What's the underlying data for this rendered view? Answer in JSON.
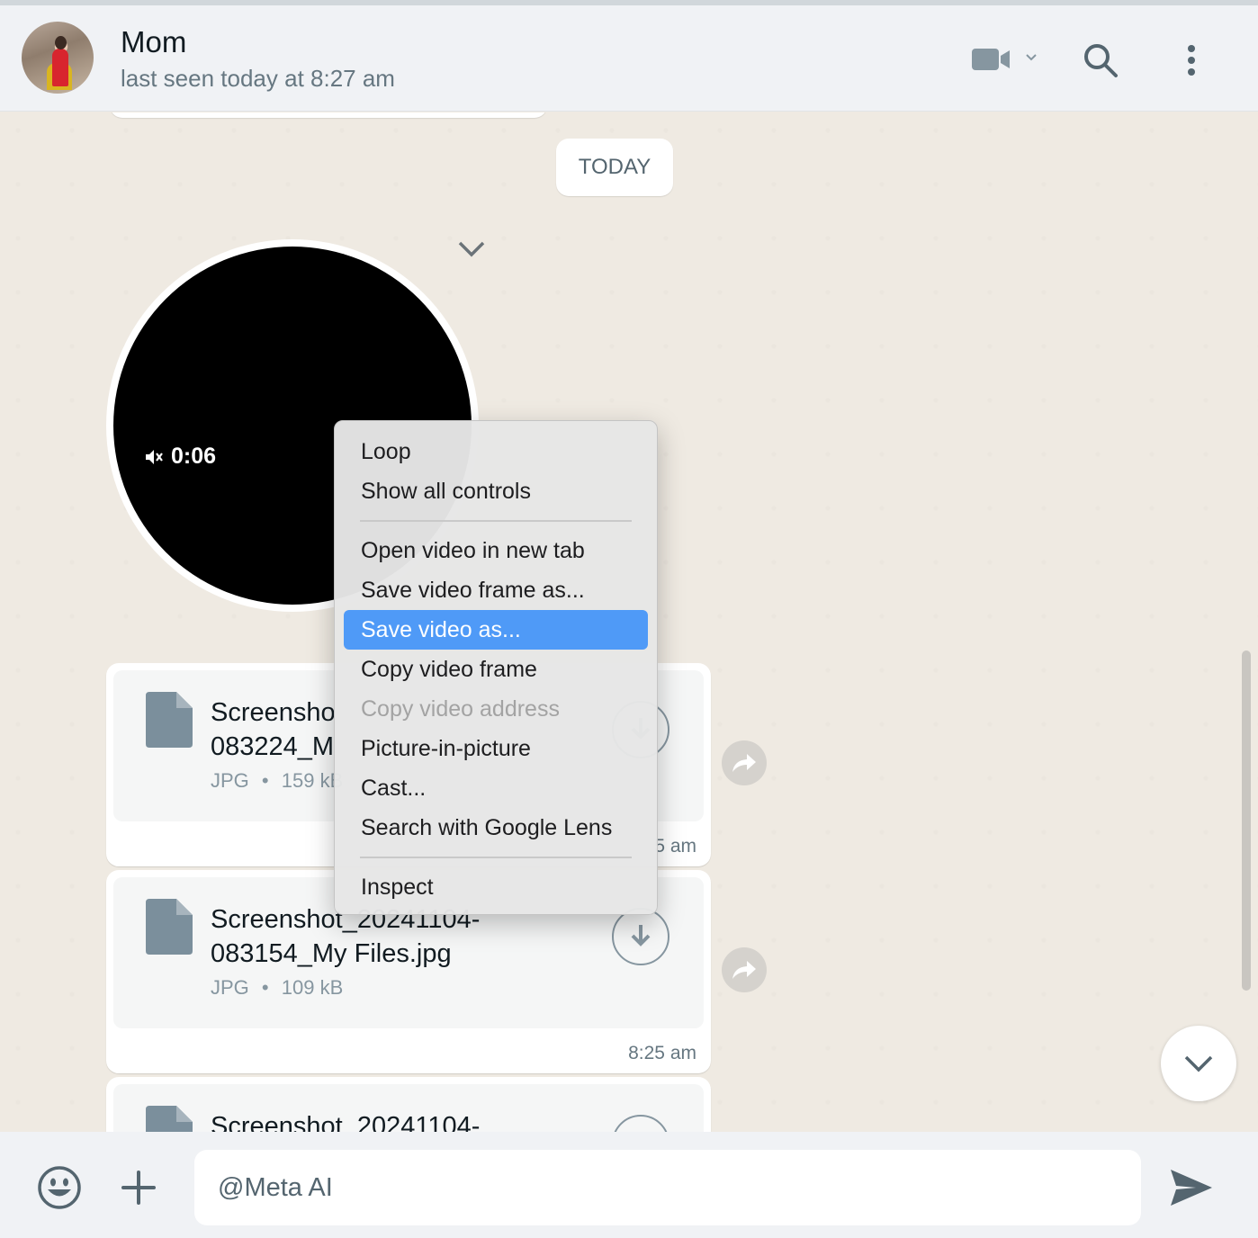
{
  "header": {
    "name": "Mom",
    "status": "last seen today at 8:27 am",
    "icons": [
      "video-call-icon",
      "chevron-down-icon",
      "search-icon",
      "more-options-icon"
    ]
  },
  "chat": {
    "date_divider": "TODAY",
    "video_message": {
      "duration": "0:06",
      "muted_icon": "muted-speaker-icon"
    },
    "files": [
      {
        "name_line1": "Screensho",
        "name_line2": "083224_M",
        "type": "JPG",
        "separator": "•",
        "size": "159 kB",
        "time": "5 am"
      },
      {
        "name_line1": "Screenshot_20241104-",
        "name_line2": "083154_My Files.jpg",
        "type": "JPG",
        "separator": "•",
        "size": "109 kB",
        "time": "8:25 am"
      },
      {
        "name_line1": "Screenshot_20241104-"
      }
    ]
  },
  "context_menu": {
    "group1": [
      "Loop",
      "Show all controls"
    ],
    "group2": [
      {
        "label": "Open video in new tab",
        "state": "normal"
      },
      {
        "label": "Save video frame as...",
        "state": "normal"
      },
      {
        "label": "Save video as...",
        "state": "active"
      },
      {
        "label": "Copy video frame",
        "state": "normal"
      },
      {
        "label": "Copy video address",
        "state": "disabled"
      },
      {
        "label": "Picture-in-picture",
        "state": "normal"
      },
      {
        "label": "Cast...",
        "state": "normal"
      },
      {
        "label": "Search with Google Lens",
        "state": "normal"
      }
    ],
    "group3": [
      "Inspect"
    ]
  },
  "footer": {
    "compose_value": "@Meta AI",
    "icons": [
      "emoji-icon",
      "plus-icon",
      "send-icon"
    ]
  },
  "colors": {
    "header_bg": "#f0f2f5",
    "chat_bg": "#efeae2",
    "menu_highlight": "#4f9af7",
    "icon_gray": "#54656f"
  }
}
